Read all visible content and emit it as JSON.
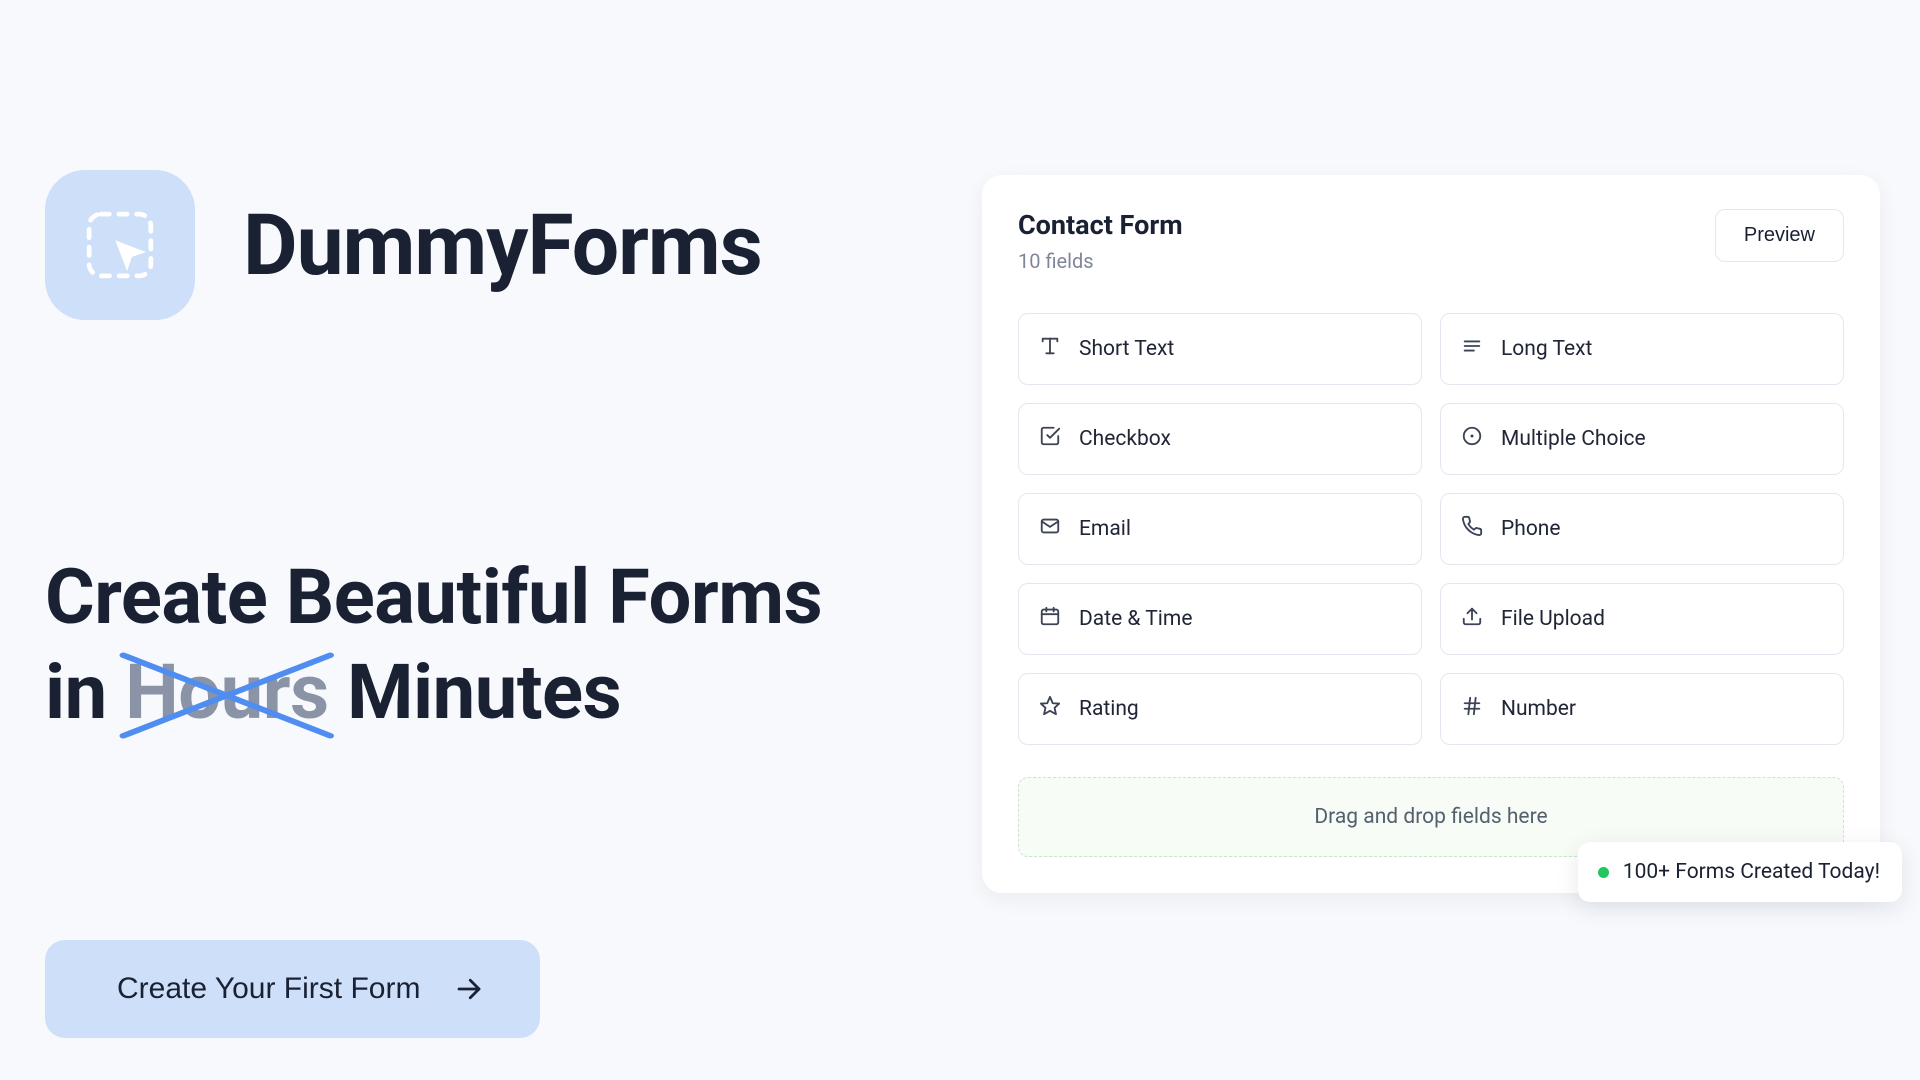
{
  "brand": {
    "name": "DummyForms"
  },
  "headline": {
    "line1": "Create Beautiful Forms",
    "line2_prefix": "in ",
    "line2_strike": "Hours",
    "line2_suffix": " Minutes"
  },
  "cta": {
    "label": "Create Your First Form"
  },
  "builder": {
    "title": "Contact Form",
    "subtitle": "10 fields",
    "preview_label": "Preview",
    "fields": [
      {
        "label": "Short Text",
        "icon": "type"
      },
      {
        "label": "Long Text",
        "icon": "lines"
      },
      {
        "label": "Checkbox",
        "icon": "check-square"
      },
      {
        "label": "Multiple Choice",
        "icon": "circle-dot"
      },
      {
        "label": "Email",
        "icon": "mail"
      },
      {
        "label": "Phone",
        "icon": "phone"
      },
      {
        "label": "Date & Time",
        "icon": "calendar"
      },
      {
        "label": "File Upload",
        "icon": "upload"
      },
      {
        "label": "Rating",
        "icon": "star"
      },
      {
        "label": "Number",
        "icon": "hash"
      }
    ],
    "dropzone": "Drag and drop fields here"
  },
  "toast": {
    "text": "100+ Forms Created Today!"
  }
}
